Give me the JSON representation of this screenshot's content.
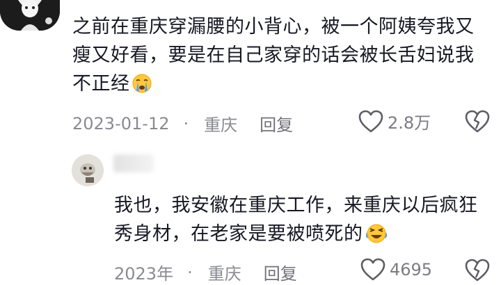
{
  "comments": [
    {
      "text": "之前在重庆穿漏腰的小背心，被一个阿姨夸我又瘦又好看，要是在自己家穿的话会被长舌妇说我不正经",
      "emoji": "crying-face-emoji",
      "date": "2023-01-12",
      "separator": "·",
      "location": "重庆",
      "reply_label": "回复",
      "like_count": "2.8万"
    },
    {
      "text": "我也，我安徽在重庆工作，来重庆以后疯狂秀身材，在老家是要被喷死的",
      "emoji": "laughing-crying-face-emoji",
      "date": "2023年",
      "separator": "·",
      "location": "重庆",
      "reply_label": "回复",
      "like_count": "4695"
    }
  ],
  "icons": {
    "like": "heart-outline-icon",
    "dislike": "broken-heart-icon"
  },
  "colors": {
    "text": "#161823",
    "meta": "#8a8b91",
    "emoji_yellow": "#ffc83d",
    "emoji_tear": "#4aa3f0"
  }
}
